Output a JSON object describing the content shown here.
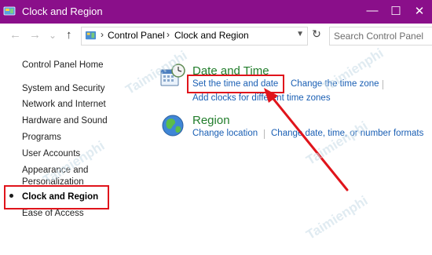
{
  "window": {
    "title": "Clock and Region",
    "controls": {
      "minimize": "—",
      "maximize": "☐",
      "close": "✕"
    }
  },
  "addressbar": {
    "back": "←",
    "forward": "→",
    "recent": "⌄",
    "up": "↑",
    "breadcrumbs": [
      "Control Panel",
      "Clock and Region"
    ],
    "separator": "›",
    "refresh": "↻",
    "search_placeholder": "Search Control Panel"
  },
  "sidebar": {
    "items": [
      {
        "label": "Control Panel Home"
      },
      {
        "label": "System and Security"
      },
      {
        "label": "Network and Internet"
      },
      {
        "label": "Hardware and Sound"
      },
      {
        "label": "Programs"
      },
      {
        "label": "User Accounts"
      },
      {
        "label": "Appearance and"
      },
      {
        "label": "Personalization"
      },
      {
        "label": "Clock and Region"
      },
      {
        "label": "Ease of Access"
      }
    ]
  },
  "categories": [
    {
      "title": "Date and Time",
      "icon": "calendar-clock-icon",
      "links": [
        "Set the time and date",
        "Change the time zone",
        "Add clocks for different time zones"
      ]
    },
    {
      "title": "Region",
      "icon": "globe-icon",
      "links": [
        "Change location",
        "Change date, time, or number formats"
      ]
    }
  ],
  "annotations": {
    "highlight_color": "#e0141b"
  },
  "watermark": {
    "text": "Taimienphi"
  },
  "colors": {
    "titlebar": "#8a0f8a",
    "category_title": "#217d2b",
    "link": "#1a5fb4"
  }
}
